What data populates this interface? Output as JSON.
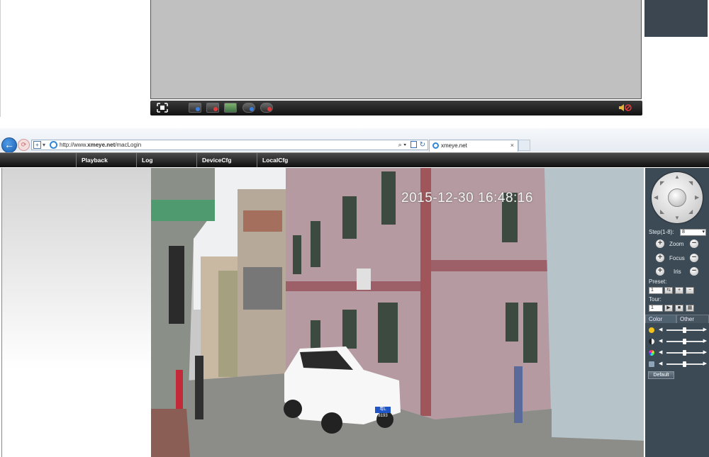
{
  "top_toolbar": {
    "buttons": [
      "fullscreen-icon",
      "record-icon",
      "stop-record-icon",
      "snapshot-icon",
      "talk-icon",
      "stop-talk-icon"
    ],
    "volume_icon": "speaker-icon"
  },
  "browser": {
    "url_prefix": "http://www.",
    "url_domain": "xmeye.net",
    "url_path": "/macLogin",
    "tab_title": "xmeye.net",
    "tab_close": "×"
  },
  "app": {
    "menu": [
      "Playback",
      "Log",
      "DeviceCfg",
      "LocalCfg"
    ],
    "video": {
      "timestamp": "2015-12-30 16:48:16",
      "plate": "粤L 8193"
    },
    "ptz": {
      "step_label": "Step(1-8):",
      "step_value": "8",
      "zoom_label": "Zoom",
      "focus_label": "Focus",
      "iris_label": "Iris",
      "preset_label": "Preset:",
      "preset_value": "1",
      "tour_label": "Tour:",
      "tour_value": "1",
      "tab_color": "Color",
      "tab_other": "Other",
      "sliders": [
        {
          "name": "brightness",
          "level": 0.5,
          "color": "#f2c31b"
        },
        {
          "name": "contrast",
          "level": 0.5,
          "color": "#dddddd"
        },
        {
          "name": "saturation",
          "level": 0.5,
          "color": "#c44bd0"
        },
        {
          "name": "hue",
          "level": 0.5,
          "color": "#8fa5b7"
        }
      ],
      "default_label": "Default"
    }
  },
  "colors": {
    "ptz_panel": "#3c4a55",
    "menubar": "#1a1a1a",
    "accent_blue": "#1b5fb4"
  }
}
